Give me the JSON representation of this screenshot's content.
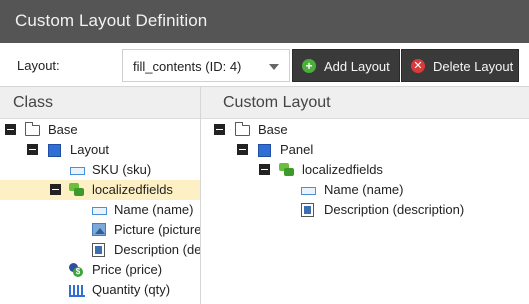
{
  "window": {
    "title": "Custom Layout Definition"
  },
  "toolbar": {
    "layout_label": "Layout:",
    "layout_value": "fill_contents (ID: 4)",
    "add_label": "Add Layout",
    "delete_label": "Delete Layout"
  },
  "class_panel": {
    "header": "Class",
    "nodes": {
      "base": "Base",
      "layout": "Layout",
      "sku": "SKU (sku)",
      "localizedfields": "localizedfields",
      "name": "Name (name)",
      "picture": "Picture (picture",
      "description": "Description (de",
      "price": "Price (price)",
      "quantity": "Quantity (qty)"
    }
  },
  "custom_panel": {
    "header": "Custom Layout",
    "nodes": {
      "base": "Base",
      "panel": "Panel",
      "localizedfields": "localizedfields",
      "name": "Name (name)",
      "description": "Description (description)"
    }
  },
  "colors": {
    "titlebar": "#555555",
    "button_bg": "#3a3a3a",
    "selection": "#fdf0c4",
    "add_icon": "#4caf3c",
    "delete_icon": "#d93b3b"
  }
}
